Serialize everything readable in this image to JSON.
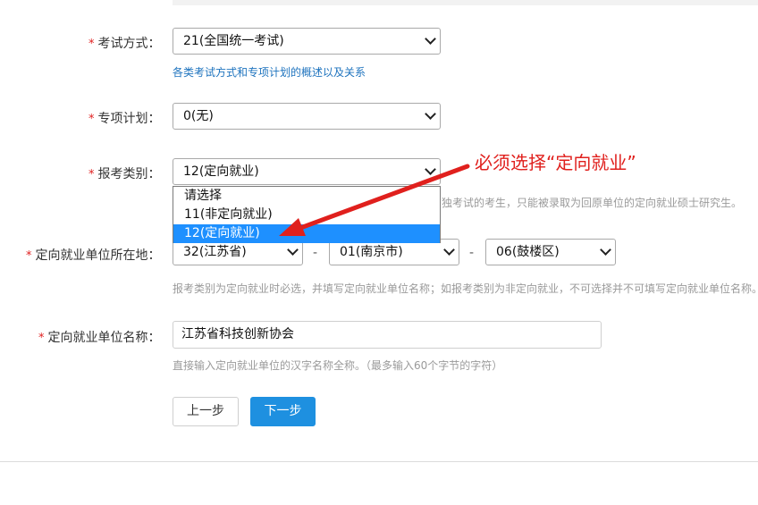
{
  "form": {
    "required_mark": "*",
    "exam_method": {
      "label": "考试方式：",
      "value": "21(全国统一考试)",
      "hint": "各类考试方式和专项计划的概述以及关系"
    },
    "special_plan": {
      "label": "专项计划：",
      "value": "0(无)"
    },
    "category": {
      "label": "报考类别：",
      "value": "12(定向就业)",
      "hint_partial": "独考试的考生，只能被录取为回原单位的定向就业硕士研究生。",
      "options": [
        "请选择",
        "11(非定向就业)",
        "12(定向就业)"
      ],
      "selected_option": "12(定向就业)"
    },
    "location": {
      "label": "定向就业单位所在地：",
      "province": "32(江苏省)",
      "city": "01(南京市)",
      "district": "06(鼓楼区)",
      "separator": "-",
      "hint": "报考类别为定向就业时必选，并填写定向就业单位名称；如报考类别为非定向就业，不可选择并不可填写定向就业单位名称。"
    },
    "unit_name": {
      "label": "定向就业单位名称：",
      "value": "江苏省科技创新协会",
      "hint": "直接输入定向就业单位的汉字名称全称。（最多输入60个字节的字符）"
    }
  },
  "buttons": {
    "prev": "上一步",
    "next": "下一步"
  },
  "annotation": {
    "text": "必须选择“定向就业”",
    "color": "#e0201d"
  },
  "colors": {
    "accent": "#1e90e0",
    "required": "#e02020",
    "link": "#1e73be",
    "selected_option_bg": "#1e90ff"
  }
}
